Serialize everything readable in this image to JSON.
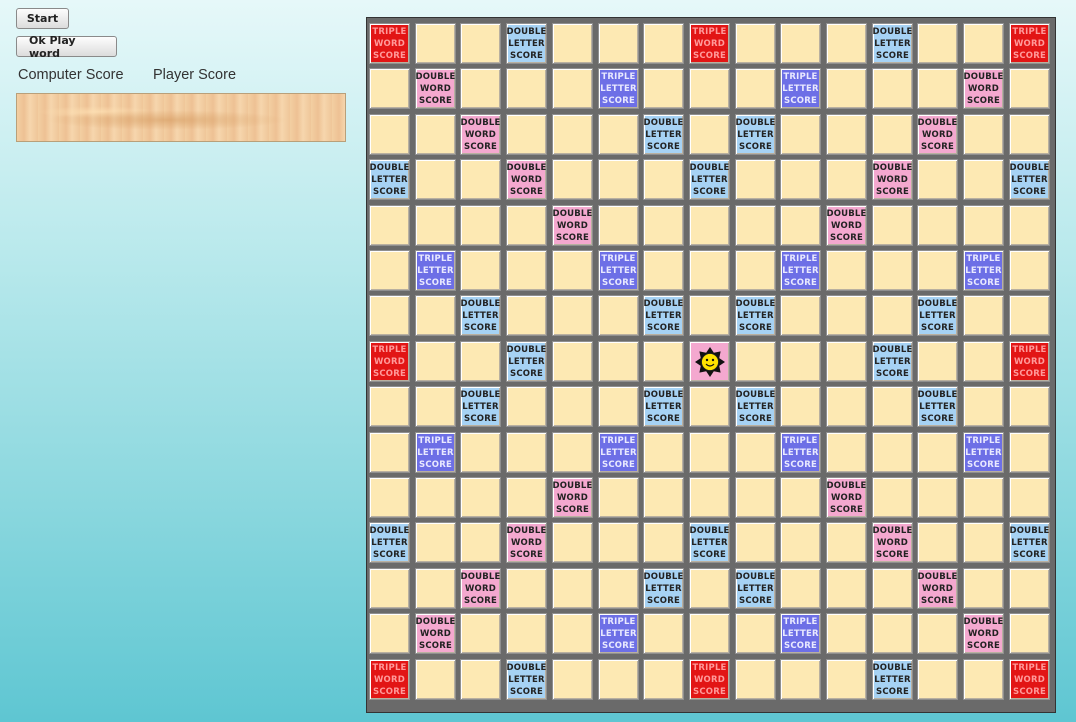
{
  "buttons": {
    "start": "Start",
    "play_word": "Ok Play word"
  },
  "scores": {
    "computer_label": "Computer Score",
    "player_label": "Player Score"
  },
  "board": {
    "size": 15,
    "premium_labels": {
      "TW": "TRIPLE\nWORD\nSCORE",
      "DW": "DOUBLE\nWORD\nSCORE",
      "TL": "TRIPLE\nLETTER\nSCORE",
      "DL": "DOUBLE\nLETTER\nSCORE"
    },
    "rows": [
      [
        "TW",
        "",
        "",
        "DL",
        "",
        "",
        "",
        "TW",
        "",
        "",
        "",
        "DL",
        "",
        "",
        "TW"
      ],
      [
        "",
        "DW",
        "",
        "",
        "",
        "TL",
        "",
        "",
        "",
        "TL",
        "",
        "",
        "",
        "DW",
        ""
      ],
      [
        "",
        "",
        "DW",
        "",
        "",
        "",
        "DL",
        "",
        "DL",
        "",
        "",
        "",
        "DW",
        "",
        ""
      ],
      [
        "DL",
        "",
        "",
        "DW",
        "",
        "",
        "",
        "DL",
        "",
        "",
        "",
        "DW",
        "",
        "",
        "DL"
      ],
      [
        "",
        "",
        "",
        "",
        "DW",
        "",
        "",
        "",
        "",
        "",
        "DW",
        "",
        "",
        "",
        ""
      ],
      [
        "",
        "TL",
        "",
        "",
        "",
        "TL",
        "",
        "",
        "",
        "TL",
        "",
        "",
        "",
        "TL",
        ""
      ],
      [
        "",
        "",
        "DL",
        "",
        "",
        "",
        "DL",
        "",
        "DL",
        "",
        "",
        "",
        "DL",
        "",
        ""
      ],
      [
        "TW",
        "",
        "",
        "DL",
        "",
        "",
        "",
        "ST",
        "",
        "",
        "",
        "DL",
        "",
        "",
        "TW"
      ],
      [
        "",
        "",
        "DL",
        "",
        "",
        "",
        "DL",
        "",
        "DL",
        "",
        "",
        "",
        "DL",
        "",
        ""
      ],
      [
        "",
        "TL",
        "",
        "",
        "",
        "TL",
        "",
        "",
        "",
        "TL",
        "",
        "",
        "",
        "TL",
        ""
      ],
      [
        "",
        "",
        "",
        "",
        "DW",
        "",
        "",
        "",
        "",
        "",
        "DW",
        "",
        "",
        "",
        ""
      ],
      [
        "DL",
        "",
        "",
        "DW",
        "",
        "",
        "",
        "DL",
        "",
        "",
        "",
        "DW",
        "",
        "",
        "DL"
      ],
      [
        "",
        "",
        "DW",
        "",
        "",
        "",
        "DL",
        "",
        "DL",
        "",
        "",
        "",
        "DW",
        "",
        ""
      ],
      [
        "",
        "DW",
        "",
        "",
        "",
        "TL",
        "",
        "",
        "",
        "TL",
        "",
        "",
        "",
        "DW",
        ""
      ],
      [
        "TW",
        "",
        "",
        "DL",
        "",
        "",
        "",
        "TW",
        "",
        "",
        "",
        "DL",
        "",
        "",
        "TW"
      ]
    ],
    "center_icon": "smiley-star-icon",
    "colors": {
      "plain": "#fde9b3",
      "TW": "#e21515",
      "DW": "#f4a8cf",
      "TL": "#6d6fe6",
      "DL": "#a6d2f4"
    }
  }
}
